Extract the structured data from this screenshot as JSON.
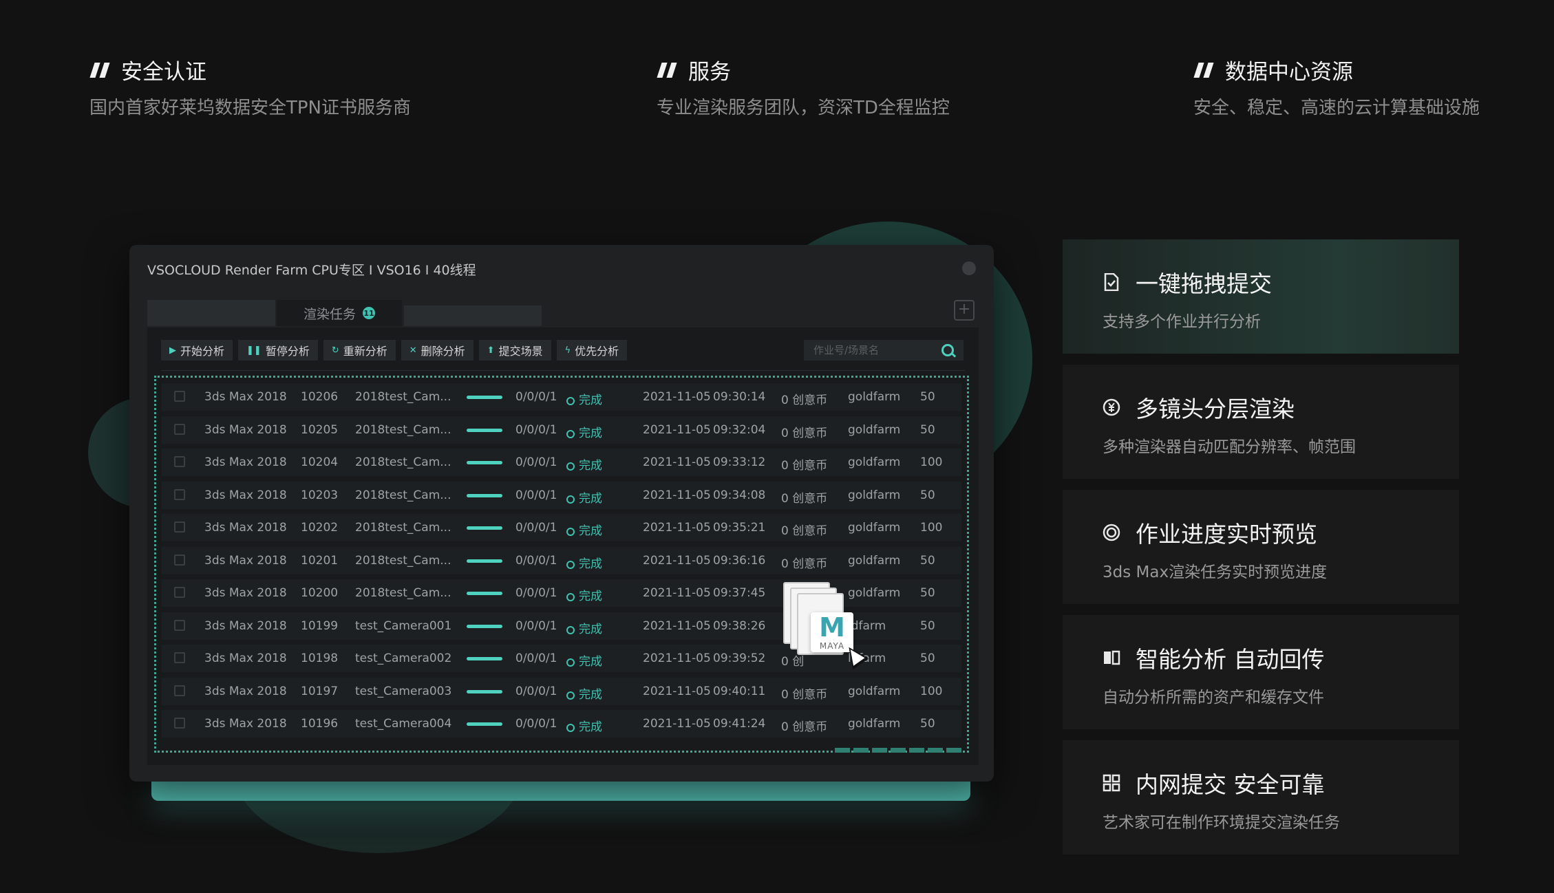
{
  "features": [
    {
      "title": "安全认证",
      "subtitle": "国内首家好莱坞数据安全TPN证书服务商"
    },
    {
      "title": "服务",
      "subtitle": "专业渲染服务团队，资深TD全程监控"
    },
    {
      "title": "数据中心资源",
      "subtitle": "安全、稳定、高速的云计算基础设施"
    }
  ],
  "app": {
    "title": "VSOCLOUD  Render Farm  CPU专区 I VSO16 I 40线程",
    "tab_label": "渲染任务",
    "tab_badge": "11",
    "add_label": "+",
    "toolbar": [
      "开始分析",
      "暂停分析",
      "重新分析",
      "删除分析",
      "提交场景",
      "优先分析"
    ],
    "toolbar_icons": [
      "▶",
      "❚❚",
      "↻",
      "✕",
      "⬆",
      "ϟ"
    ],
    "search_placeholder": "作业号/场景名",
    "rows": [
      {
        "software": "3ds Max 2018",
        "id": "10206",
        "scene": "2018test_Cam...",
        "frames": "0/0/0/1",
        "status": "完成",
        "date": "2021-11-05",
        "time": "09:30:14",
        "cost": "0 创意币",
        "user": "goldfarm",
        "priority": "50"
      },
      {
        "software": "3ds Max 2018",
        "id": "10205",
        "scene": "2018test_Cam...",
        "frames": "0/0/0/1",
        "status": "完成",
        "date": "2021-11-05",
        "time": "09:32:04",
        "cost": "0 创意币",
        "user": "goldfarm",
        "priority": "50"
      },
      {
        "software": "3ds Max 2018",
        "id": "10204",
        "scene": "2018test_Cam...",
        "frames": "0/0/0/1",
        "status": "完成",
        "date": "2021-11-05",
        "time": "09:33:12",
        "cost": "0 创意币",
        "user": "goldfarm",
        "priority": "100"
      },
      {
        "software": "3ds Max 2018",
        "id": "10203",
        "scene": "2018test_Cam...",
        "frames": "0/0/0/1",
        "status": "完成",
        "date": "2021-11-05",
        "time": "09:34:08",
        "cost": "0 创意币",
        "user": "goldfarm",
        "priority": "50"
      },
      {
        "software": "3ds Max 2018",
        "id": "10202",
        "scene": "2018test_Cam...",
        "frames": "0/0/0/1",
        "status": "完成",
        "date": "2021-11-05",
        "time": "09:35:21",
        "cost": "0 创意币",
        "user": "goldfarm",
        "priority": "100"
      },
      {
        "software": "3ds Max 2018",
        "id": "10201",
        "scene": "2018test_Cam...",
        "frames": "0/0/0/1",
        "status": "完成",
        "date": "2021-11-05",
        "time": "09:36:16",
        "cost": "0 创意币",
        "user": "goldfarm",
        "priority": "50"
      },
      {
        "software": "3ds Max 2018",
        "id": "10200",
        "scene": "2018test_Cam...",
        "frames": "0/0/0/1",
        "status": "完成",
        "date": "2021-11-05",
        "time": "09:37:45",
        "cost": "",
        "user": "goldfarm",
        "priority": "50"
      },
      {
        "software": "3ds Max 2018",
        "id": "10199",
        "scene": "test_Camera001",
        "frames": "0/0/0/1",
        "status": "完成",
        "date": "2021-11-05",
        "time": "09:38:26",
        "cost": "",
        "user": "ldfarm",
        "priority": "50"
      },
      {
        "software": "3ds Max 2018",
        "id": "10198",
        "scene": "test_Camera002",
        "frames": "0/0/0/1",
        "status": "完成",
        "date": "2021-11-05",
        "time": "09:39:52",
        "cost": "0 创",
        "user": "ldfarm",
        "priority": "50"
      },
      {
        "software": "3ds Max 2018",
        "id": "10197",
        "scene": "test_Camera003",
        "frames": "0/0/0/1",
        "status": "完成",
        "date": "2021-11-05",
        "time": "09:40:11",
        "cost": "0 创意币",
        "user": "goldfarm",
        "priority": "100"
      },
      {
        "software": "3ds Max 2018",
        "id": "10196",
        "scene": "test_Camera004",
        "frames": "0/0/0/1",
        "status": "完成",
        "date": "2021-11-05",
        "time": "09:41:24",
        "cost": "0 创意币",
        "user": "goldfarm",
        "priority": "50"
      }
    ],
    "drag_file": {
      "letter": "M",
      "label": "MAYA"
    }
  },
  "cards": [
    {
      "title": "一键拖拽提交",
      "subtitle": "支持多个作业并行分析",
      "icon": "document-check-icon"
    },
    {
      "title": "多镜头分层渲染",
      "subtitle": "多种渲染器自动匹配分辨率、帧范围",
      "icon": "coin-icon"
    },
    {
      "title": "作业进度实时预览",
      "subtitle": "3ds Max渲染任务实时预览进度",
      "icon": "target-icon"
    },
    {
      "title": "智能分析 自动回传",
      "subtitle": "自动分析所需的资产和缓存文件",
      "icon": "split-panel-icon"
    },
    {
      "title": "内网提交 安全可靠",
      "subtitle": "艺术家可在制作环境提交渲染任务",
      "icon": "grid-icon"
    }
  ],
  "colors": {
    "accent": "#4fd1c0",
    "background": "#121212",
    "card_active": "#243a34"
  }
}
